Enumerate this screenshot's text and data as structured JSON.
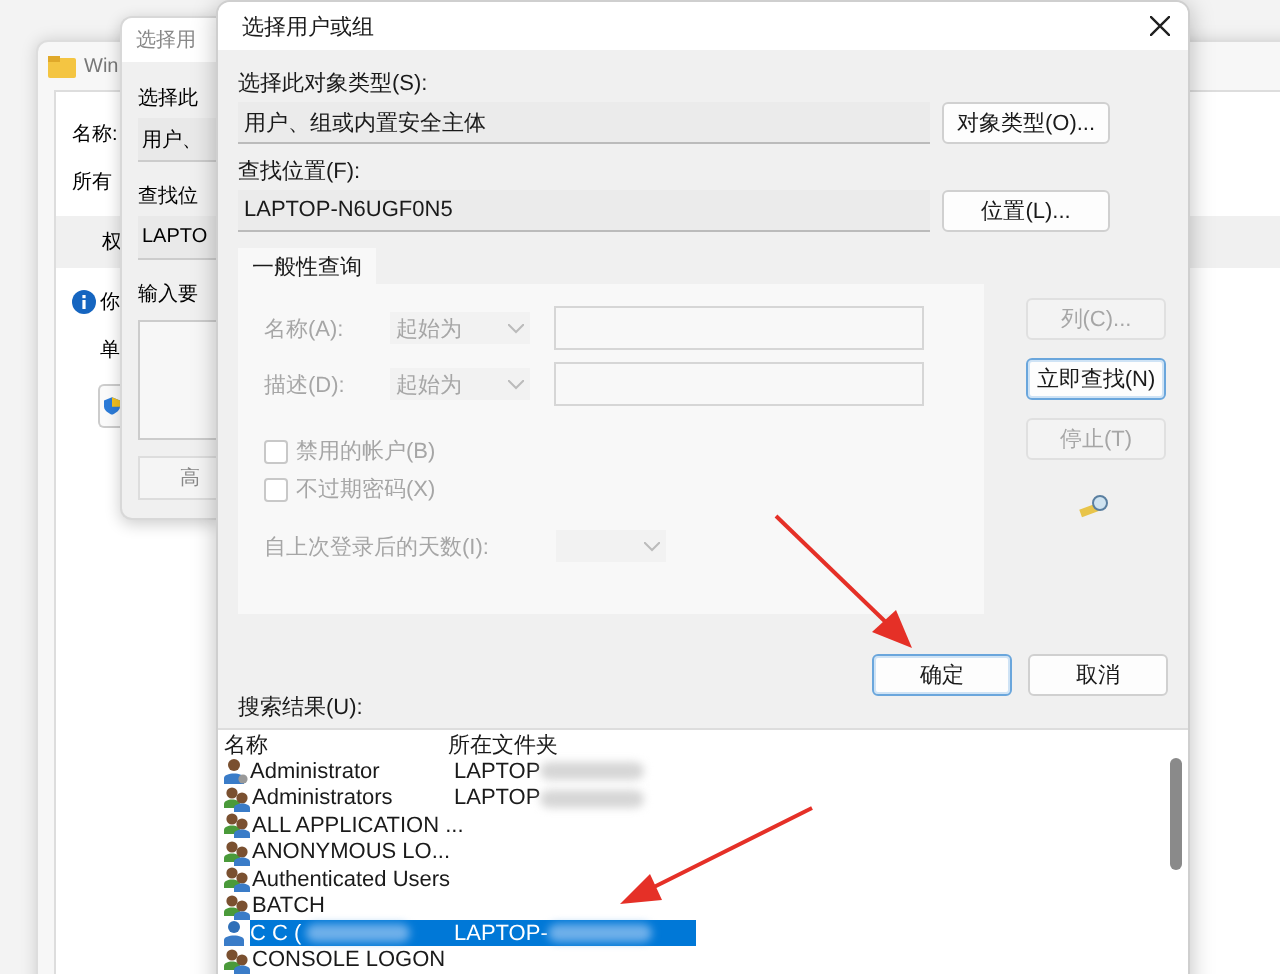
{
  "explorer_window": {
    "title": "Win",
    "name_label": "名称:",
    "owner_label": "所有",
    "tab_label": "权",
    "info_text": "你",
    "item_label": "单"
  },
  "behind_dialog": {
    "title": "选择用",
    "type_label": "选择此",
    "type_value": "用户、",
    "location_label": "查找位",
    "location_value": "LAPTO",
    "input_label": "输入要",
    "advanced_button": "高"
  },
  "dialog": {
    "title": "选择用户或组",
    "object_type_label": "选择此对象类型(S):",
    "object_type_value": "用户、组或内置安全主体",
    "object_types_button": "对象类型(O)...",
    "location_label": "查找位置(F):",
    "location_value": "LAPTOP-N6UGF0N5",
    "locations_button": "位置(L)...",
    "tabs": [
      {
        "label": "一般性查询",
        "selected": true
      }
    ],
    "query": {
      "disabled": true,
      "name_label": "名称(A):",
      "name_mode": "起始为",
      "description_label": "描述(D):",
      "description_mode": "起始为",
      "checkboxes": [
        {
          "label": "禁用的帐户(B)",
          "checked": false
        },
        {
          "label": "不过期密码(X)",
          "checked": false
        }
      ],
      "days_label": "自上次登录后的天数(I):"
    },
    "side_buttons": [
      {
        "label": "列(C)...",
        "disabled": true,
        "default": false
      },
      {
        "label": "立即查找(N)",
        "disabled": false,
        "default": true
      },
      {
        "label": "停止(T)",
        "disabled": true,
        "default": false
      }
    ],
    "ok_button": {
      "label": "确定",
      "default": true
    },
    "cancel_button": {
      "label": "取消",
      "default": false
    },
    "results_label": "搜索结果(U):",
    "results": {
      "columns": [
        "名称",
        "所在文件夹"
      ],
      "rows": [
        {
          "name": "Administrator",
          "folder": "LAPTOP",
          "kind": "user",
          "selected": false,
          "redacted": true
        },
        {
          "name": "Administrators",
          "folder": "LAPTOP",
          "kind": "group",
          "selected": false,
          "redacted": true
        },
        {
          "name": "ALL APPLICATION ...",
          "kind": "group",
          "selected": false,
          "redacted": false
        },
        {
          "name": "ANONYMOUS LO...",
          "kind": "group",
          "selected": false,
          "redacted": false
        },
        {
          "name": "Authenticated Users",
          "kind": "group",
          "selected": false,
          "redacted": false
        },
        {
          "name": "BATCH",
          "kind": "group",
          "selected": false,
          "redacted": false
        },
        {
          "name": "C C (",
          "folder": "LAPTOP-",
          "kind": "user",
          "selected": true,
          "redacted": true
        },
        {
          "name": "CONSOLE LOGON",
          "kind": "group",
          "selected": false,
          "redacted": false
        }
      ]
    }
  }
}
